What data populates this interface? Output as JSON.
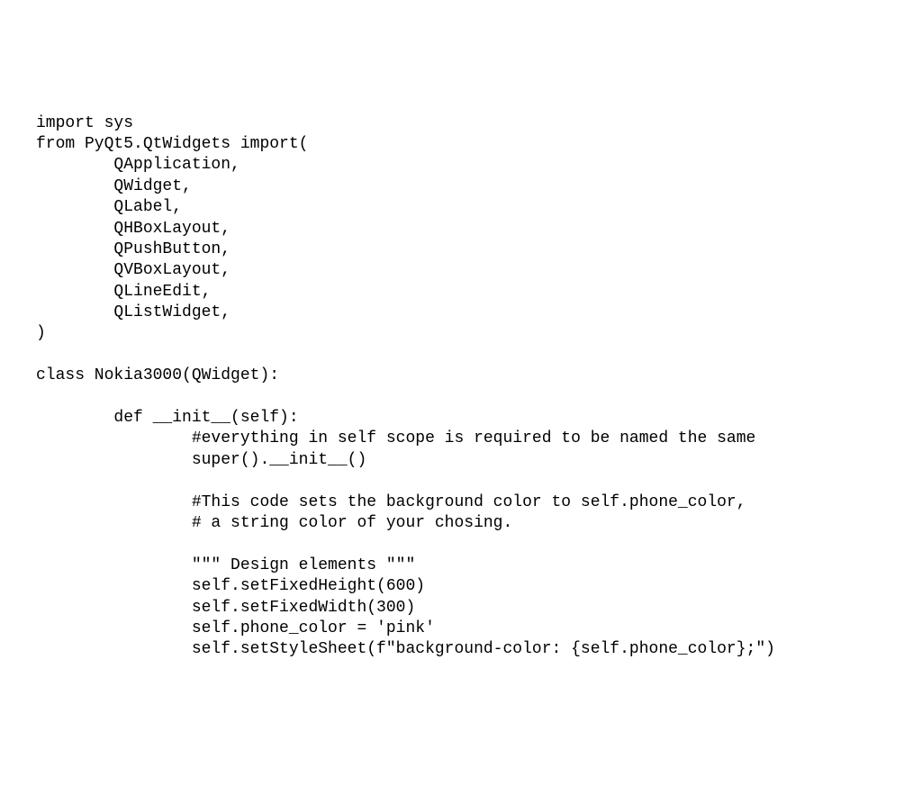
{
  "code": {
    "lines": [
      "import sys",
      "from PyQt5.QtWidgets import(",
      "        QApplication,",
      "        QWidget,",
      "        QLabel,",
      "        QHBoxLayout,",
      "        QPushButton,",
      "        QVBoxLayout,",
      "        QLineEdit,",
      "        QListWidget,",
      ")",
      "",
      "class Nokia3000(QWidget):",
      "",
      "        def __init__(self):",
      "                #everything in self scope is required to be named the same",
      "                super().__init__()",
      "",
      "                #This code sets the background color to self.phone_color,",
      "                # a string color of your chosing.",
      "",
      "                \"\"\" Design elements \"\"\"",
      "                self.setFixedHeight(600)",
      "                self.setFixedWidth(300)",
      "                self.phone_color = 'pink'",
      "                self.setStyleSheet(f\"background-color: {self.phone_color};\")"
    ]
  }
}
